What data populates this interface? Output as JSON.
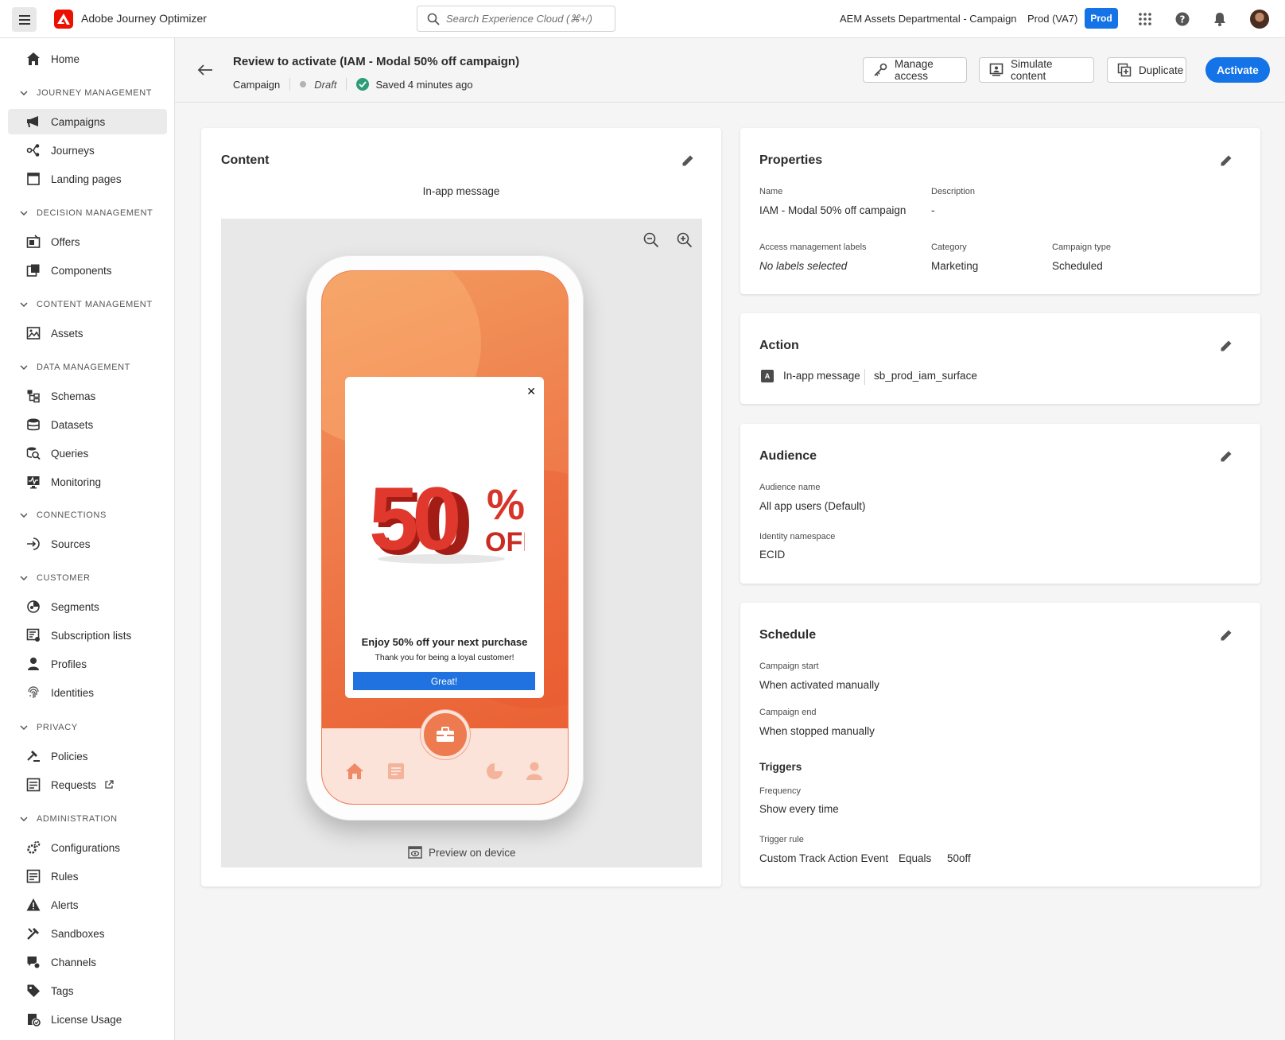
{
  "app": {
    "name": "Adobe Journey Optimizer"
  },
  "search": {
    "placeholder": "Search Experience Cloud (⌘+/)"
  },
  "topbar": {
    "org": "AEM Assets Departmental - Campaign",
    "sandbox": "Prod (VA7)",
    "env_badge": "Prod"
  },
  "sidebar": {
    "home": "Home",
    "sections": {
      "journey": "JOURNEY MANAGEMENT",
      "decision": "DECISION MANAGEMENT",
      "content": "CONTENT MANAGEMENT",
      "data": "DATA MANAGEMENT",
      "connections": "CONNECTIONS",
      "customer": "CUSTOMER",
      "privacy": "PRIVACY",
      "admin": "ADMINISTRATION"
    },
    "items": {
      "campaigns": "Campaigns",
      "journeys": "Journeys",
      "landing_pages": "Landing pages",
      "offers": "Offers",
      "components": "Components",
      "assets": "Assets",
      "schemas": "Schemas",
      "datasets": "Datasets",
      "queries": "Queries",
      "monitoring": "Monitoring",
      "sources": "Sources",
      "segments": "Segments",
      "subscription_lists": "Subscription lists",
      "profiles": "Profiles",
      "identities": "Identities",
      "policies": "Policies",
      "requests": "Requests",
      "configurations": "Configurations",
      "rules": "Rules",
      "alerts": "Alerts",
      "sandboxes": "Sandboxes",
      "channels": "Channels",
      "tags": "Tags",
      "license_usage": "License Usage"
    }
  },
  "header": {
    "title": "Review to activate (IAM - Modal 50% off campaign)",
    "type": "Campaign",
    "status": "Draft",
    "saved": "Saved 4 minutes ago",
    "buttons": {
      "manage_access": "Manage access",
      "simulate": "Simulate content",
      "duplicate": "Duplicate",
      "activate": "Activate"
    }
  },
  "content": {
    "title": "Content",
    "channel": "In-app message",
    "offer": {
      "big_text": "50",
      "percent": "%",
      "off": "OFF",
      "title": "Enjoy 50% off your next purchase",
      "subtitle": "Thank you for being a loyal customer!",
      "button": "Great!",
      "close": "✕"
    },
    "preview_on_device": "Preview on device"
  },
  "properties": {
    "title": "Properties",
    "name_label": "Name",
    "name": "IAM - Modal 50% off campaign",
    "description_label": "Description",
    "description": "-",
    "access_label": "Access management labels",
    "access": "No labels selected",
    "category_label": "Category",
    "category": "Marketing",
    "campaign_type_label": "Campaign type",
    "campaign_type": "Scheduled"
  },
  "action": {
    "title": "Action",
    "badge": "A",
    "channel": "In-app message",
    "surface": "sb_prod_iam_surface"
  },
  "audience": {
    "title": "Audience",
    "name_label": "Audience name",
    "name": "All app users (Default)",
    "namespace_label": "Identity namespace",
    "namespace": "ECID"
  },
  "schedule": {
    "title": "Schedule",
    "start_label": "Campaign start",
    "start": "When activated manually",
    "end_label": "Campaign end",
    "end": "When stopped manually",
    "triggers_title": "Triggers",
    "frequency_label": "Frequency",
    "frequency": "Show every time",
    "trigger_rule_label": "Trigger rule",
    "trigger_event": "Custom Track Action Event",
    "trigger_op": "Equals",
    "trigger_value": "50off"
  },
  "colors": {
    "accent": "#1473e6",
    "adobe_red": "#eb1000",
    "success": "#2d9d78",
    "phone_orange": "#ef7a4a"
  },
  "icons": [
    "menu-icon",
    "adobe-logo-icon",
    "search-icon",
    "apps-grid-icon",
    "help-icon",
    "bell-icon",
    "home-icon",
    "megaphone-icon",
    "journey-icon",
    "landing-page-icon",
    "offer-icon",
    "components-icon",
    "assets-icon",
    "schema-icon",
    "dataset-icon",
    "query-icon",
    "monitoring-icon",
    "sources-icon",
    "segments-icon",
    "subscription-icon",
    "profile-icon",
    "fingerprint-icon",
    "policy-icon",
    "requests-icon",
    "external-link-icon",
    "configurations-icon",
    "rules-icon",
    "alert-icon",
    "sandbox-icon",
    "channels-icon",
    "tag-icon",
    "license-icon",
    "back-arrow-icon",
    "key-icon",
    "simulate-icon",
    "duplicate-icon",
    "pencil-icon",
    "zoom-out-icon",
    "zoom-in-icon",
    "preview-device-icon",
    "check-circle-icon"
  ]
}
